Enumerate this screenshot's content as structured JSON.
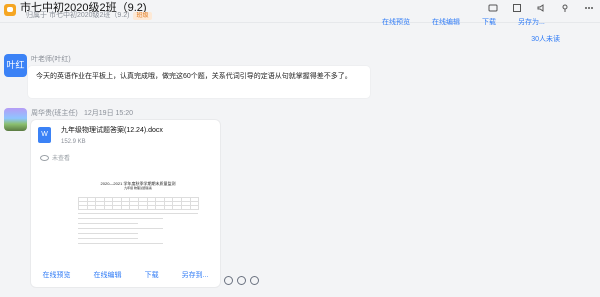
{
  "header": {
    "title": "市七中初2020级2班（9.2)",
    "subtitle": "归属于 市七中初2020级2班（9.2)",
    "badge": "班级"
  },
  "top_links": [
    "在线预览",
    "在线编辑",
    "下载",
    "另存为..."
  ],
  "unread": "30人未读",
  "messages": [
    {
      "sender": "叶老师(叶红)",
      "avatar_text": "叶红",
      "text": "今天的英语作业在平板上，认真完成哦，做完这60个题，关系代词引导的定语从句就掌握得差不多了。"
    },
    {
      "sender": "周华贵(班主任)",
      "time": "12月19日 15:20",
      "file": {
        "name": "九年级物理试题答案(12.24).docx",
        "size": "152.9 KB",
        "viewed": "未查看"
      },
      "preview": {
        "title": "2020—2021 学年度秋季学期期末质量监测",
        "subtitle": "九年级    物理试题答案"
      }
    }
  ],
  "file_actions": [
    "在线预览",
    "在线编辑",
    "下载",
    "另存到..."
  ],
  "icons": [
    "video-call-icon",
    "call-icon",
    "mute-icon",
    "pin-icon",
    "more-icon"
  ],
  "colors": {
    "accent": "#2f7bf6",
    "badge": "#e07a1f",
    "bg": "#f3f4f6"
  }
}
